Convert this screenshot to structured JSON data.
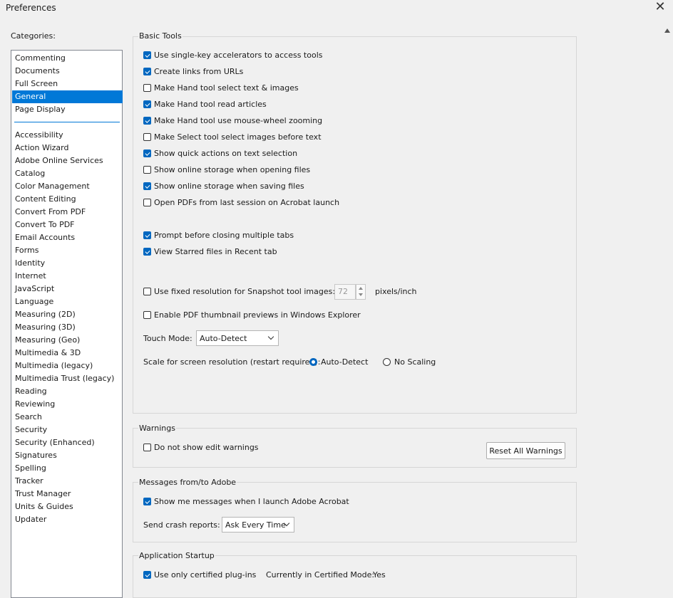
{
  "window": {
    "title": "Preferences"
  },
  "categories": {
    "label": "Categories:",
    "top_items": [
      "Commenting",
      "Documents",
      "Full Screen",
      "General",
      "Page Display"
    ],
    "selected": "General",
    "items": [
      "Accessibility",
      "Action Wizard",
      "Adobe Online Services",
      "Catalog",
      "Color Management",
      "Content Editing",
      "Convert From PDF",
      "Convert To PDF",
      "Email Accounts",
      "Forms",
      "Identity",
      "Internet",
      "JavaScript",
      "Language",
      "Measuring (2D)",
      "Measuring (3D)",
      "Measuring (Geo)",
      "Multimedia & 3D",
      "Multimedia (legacy)",
      "Multimedia Trust (legacy)",
      "Reading",
      "Reviewing",
      "Search",
      "Security",
      "Security (Enhanced)",
      "Signatures",
      "Spelling",
      "Tracker",
      "Trust Manager",
      "Units & Guides",
      "Updater"
    ]
  },
  "basic_tools": {
    "title": "Basic Tools",
    "checkboxes": [
      {
        "label": "Use single-key accelerators to access tools",
        "checked": true
      },
      {
        "label": "Create links from URLs",
        "checked": true
      },
      {
        "label": "Make Hand tool select text & images",
        "checked": false
      },
      {
        "label": "Make Hand tool read articles",
        "checked": true
      },
      {
        "label": "Make Hand tool use mouse-wheel zooming",
        "checked": true
      },
      {
        "label": "Make Select tool select images before text",
        "checked": false
      },
      {
        "label": "Show quick actions on text selection",
        "checked": true
      },
      {
        "label": "Show online storage when opening files",
        "checked": false
      },
      {
        "label": "Show online storage when saving files",
        "checked": true
      },
      {
        "label": "Open PDFs from last session on Acrobat launch",
        "checked": false
      }
    ],
    "checkboxes2": [
      {
        "label": "Prompt before closing multiple tabs",
        "checked": true
      },
      {
        "label": "View Starred files in Recent tab",
        "checked": true
      }
    ],
    "snapshot": {
      "label": "Use fixed resolution for Snapshot tool images:",
      "checked": false,
      "value": "72",
      "unit": "pixels/inch"
    },
    "thumbnail": {
      "label": "Enable PDF thumbnail previews in Windows Explorer",
      "checked": false
    },
    "touch_mode": {
      "label": "Touch Mode:",
      "value": "Auto-Detect"
    },
    "scale": {
      "label": "Scale for screen resolution (restart required):",
      "option_auto": "Auto-Detect",
      "option_none": "No Scaling",
      "selected": "Auto-Detect"
    }
  },
  "warnings": {
    "title": "Warnings",
    "checkbox": {
      "label": "Do not show edit warnings",
      "checked": false
    },
    "reset_button": "Reset All Warnings"
  },
  "messages": {
    "title": "Messages from/to Adobe",
    "checkbox": {
      "label": "Show me messages when I launch Adobe Acrobat",
      "checked": true
    },
    "crash_label": "Send crash reports:",
    "crash_value": "Ask Every Time"
  },
  "startup": {
    "title": "Application Startup",
    "checkbox": {
      "label": "Use only certified plug-ins",
      "checked": true
    },
    "mode_label": "Currently in Certified Mode:",
    "mode_value": "Yes"
  }
}
